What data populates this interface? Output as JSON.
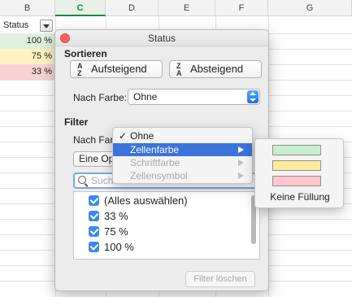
{
  "sheet": {
    "columns": [
      "B",
      "C",
      "D",
      "E",
      "F",
      "G"
    ],
    "active_column": "C",
    "header_cell": "Status",
    "rows": [
      {
        "value": "100 %",
        "color": "#dff1dc"
      },
      {
        "value": "75 %",
        "color": "#fff3c4"
      },
      {
        "value": "33 %",
        "color": "#f9d2d6"
      }
    ]
  },
  "panel": {
    "title": "Status",
    "sort_section": "Sortieren",
    "sort_ascending": "Aufsteigend",
    "sort_descending": "Absteigend",
    "sort_ascending_icon": "A\nZ",
    "sort_descending_icon": "Z\nA",
    "by_color_label": "Nach Farbe:",
    "by_color_value": "Ohne",
    "filter_section": "Filter",
    "filter_by_color_label": "Nach Farb",
    "option_button": "Eine Opt",
    "search_placeholder": "Such",
    "list_items": [
      "(Alles auswählen)",
      "33 %",
      "75 %",
      "100 %"
    ],
    "clear_filter": "Filter löschen"
  },
  "menu": {
    "items": [
      {
        "label": "Ohne",
        "checked": true,
        "state": "normal"
      },
      {
        "label": "Zellenfarbe",
        "state": "selected",
        "submenu": true
      },
      {
        "label": "Schriftfarbe",
        "state": "disabled",
        "submenu": true
      },
      {
        "label": "Zellensymbol",
        "state": "disabled",
        "submenu": true
      }
    ],
    "checkmark": "✓"
  },
  "color_submenu": {
    "swatches": [
      "#c6efce",
      "#ffeb9c",
      "#ffc7ce"
    ],
    "no_fill_label": "Keine Füllung"
  },
  "colors": {
    "accent": "#1a8a3a",
    "selection_blue": "#3b73d9",
    "checkbox_blue": "#3b88f0"
  }
}
